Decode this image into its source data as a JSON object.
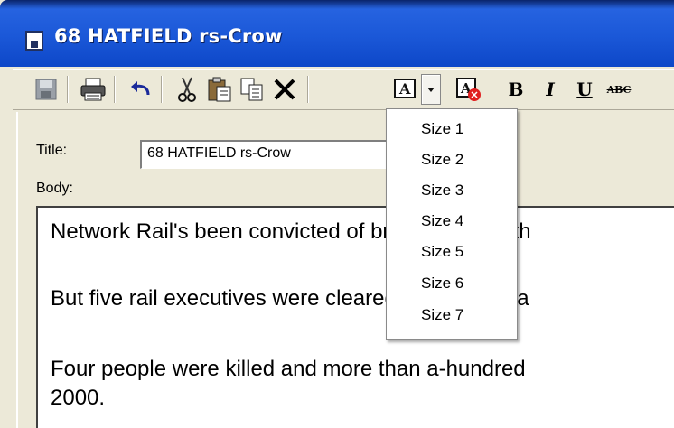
{
  "window": {
    "title": "68 HATFIELD rs-Crow"
  },
  "toolbar": {
    "buttons": [
      "save",
      "print",
      "undo",
      "cut",
      "paste",
      "copy",
      "delete",
      "font-size",
      "font-color",
      "bold",
      "italic",
      "underline",
      "strikethrough"
    ],
    "bold_label": "B",
    "italic_label": "I",
    "underline_label": "U",
    "strike_label": "ABC",
    "fontsize_label": "A"
  },
  "form": {
    "title_label": "Title:",
    "title_value": "68 HATFIELD rs-Crow",
    "body_label": "Body:",
    "body_paragraphs": [
      "Network Rail's been convicted of breaching health",
      "But five rail executives were cleared at the Old Ba",
      "Four people were killed and more than a-hundred",
      "2000."
    ]
  },
  "size_menu": {
    "items": [
      "Size 1",
      "Size 2",
      "Size 3",
      "Size 4",
      "Size 5",
      "Size 6",
      "Size 7"
    ]
  },
  "colors": {
    "titlebar": "#1b58d8",
    "chrome": "#ece9d8",
    "delete_icon": "#000000",
    "font_color_badge": "#e02020"
  }
}
